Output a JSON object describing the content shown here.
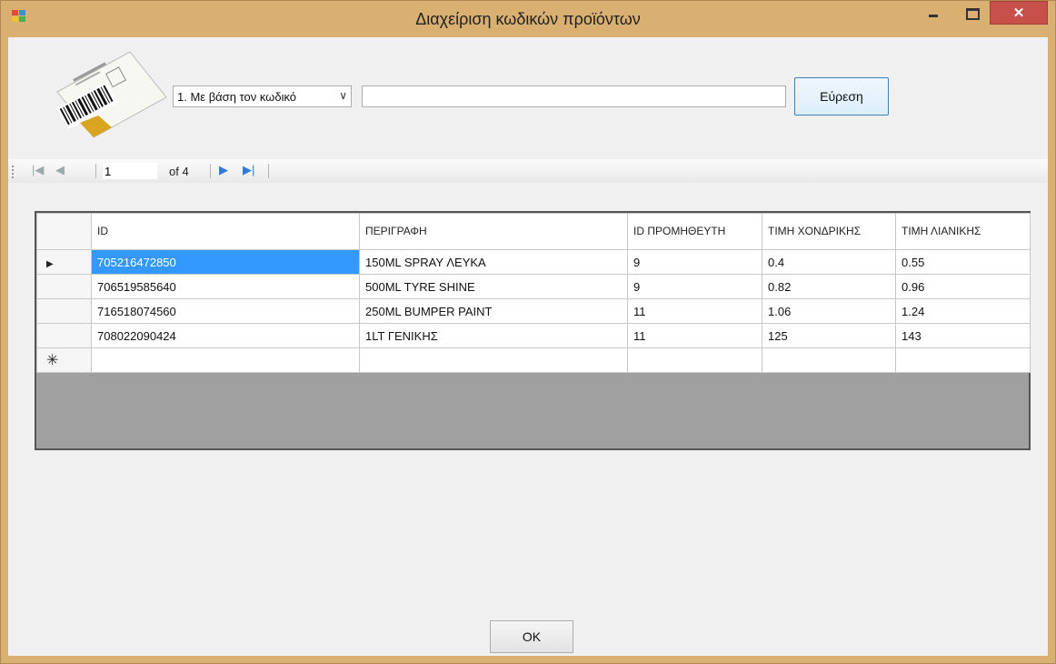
{
  "window": {
    "title": "Διαχείριση κωδικών προϊόντων",
    "close_glyph": "✕",
    "accent": "#d9b071"
  },
  "search": {
    "mode_selected": "1. Με βάση τον κωδικό",
    "query_value": "",
    "find_label": "Εύρεση"
  },
  "navigator": {
    "position": "1",
    "count_label": "of 4",
    "icons": [
      "move-first-icon",
      "move-previous-icon",
      "move-next-icon",
      "move-last-icon"
    ]
  },
  "grid": {
    "columns": [
      "ID",
      "ΠΕΡΙΓΡΑΦΗ",
      "ID ΠΡΟΜΗΘΕΥΤΗ",
      "ΤΙΜΗ ΧΟΝΔΡΙΚΗΣ",
      "ΤΙΜΗ ΛΙΑΝΙΚΗΣ"
    ],
    "rows": [
      [
        "705216472850",
        "150ML SPRAY ΛΕΥΚΑ",
        "9",
        "0.4",
        "0.55"
      ],
      [
        "706519585640",
        "500ML TYRE SHINE",
        "9",
        "0.82",
        "0.96"
      ],
      [
        "716518074560",
        "250ML BUMPER PAINT",
        "11",
        "1.06",
        "1.24"
      ],
      [
        "708022090424",
        "1LT ΓΕΝΙΚΗΣ",
        "11",
        "125",
        "143"
      ]
    ],
    "current_row_marker": "▶",
    "new_row_marker": "✳",
    "selection_color": "#3399ff"
  },
  "footer": {
    "ok_label": "OK"
  }
}
